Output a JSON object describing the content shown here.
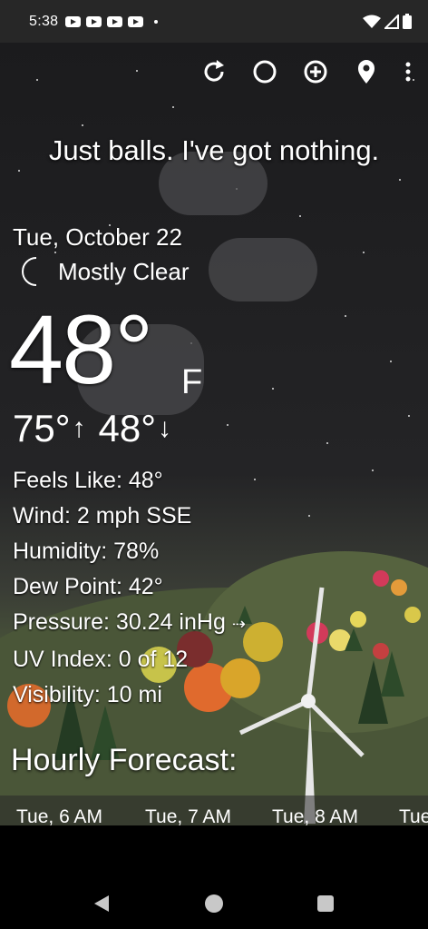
{
  "status_bar": {
    "time": "5:38"
  },
  "header": {
    "quote": "Just balls. I've got nothing."
  },
  "current": {
    "date": "Tue, October 22",
    "condition": "Mostly Clear",
    "condition_icon": "moon-icon",
    "temperature": "48°",
    "unit": "F",
    "high": "75°",
    "low": "48°"
  },
  "details": {
    "feels_like": "Feels Like:  48°",
    "wind": "Wind:  2 mph SSE",
    "humidity": "Humidity:  78%",
    "dew_point": "Dew Point:  42°",
    "pressure": "Pressure:  30.24 inHg",
    "uv_index": "UV Index:  0 of 12",
    "visibility": "Visibility:  10 mi"
  },
  "hourly": {
    "title": "Hourly Forecast:",
    "items": [
      "Tue, 6 AM",
      "Tue, 7 AM",
      "Tue, 8 AM",
      "Tue"
    ]
  },
  "toolbar_icons": [
    "refresh-icon",
    "theme-icon",
    "add-icon",
    "location-icon",
    "more-vert-icon"
  ],
  "colors": {
    "moon": "#5a8fe0",
    "background": "#1e1e20"
  }
}
